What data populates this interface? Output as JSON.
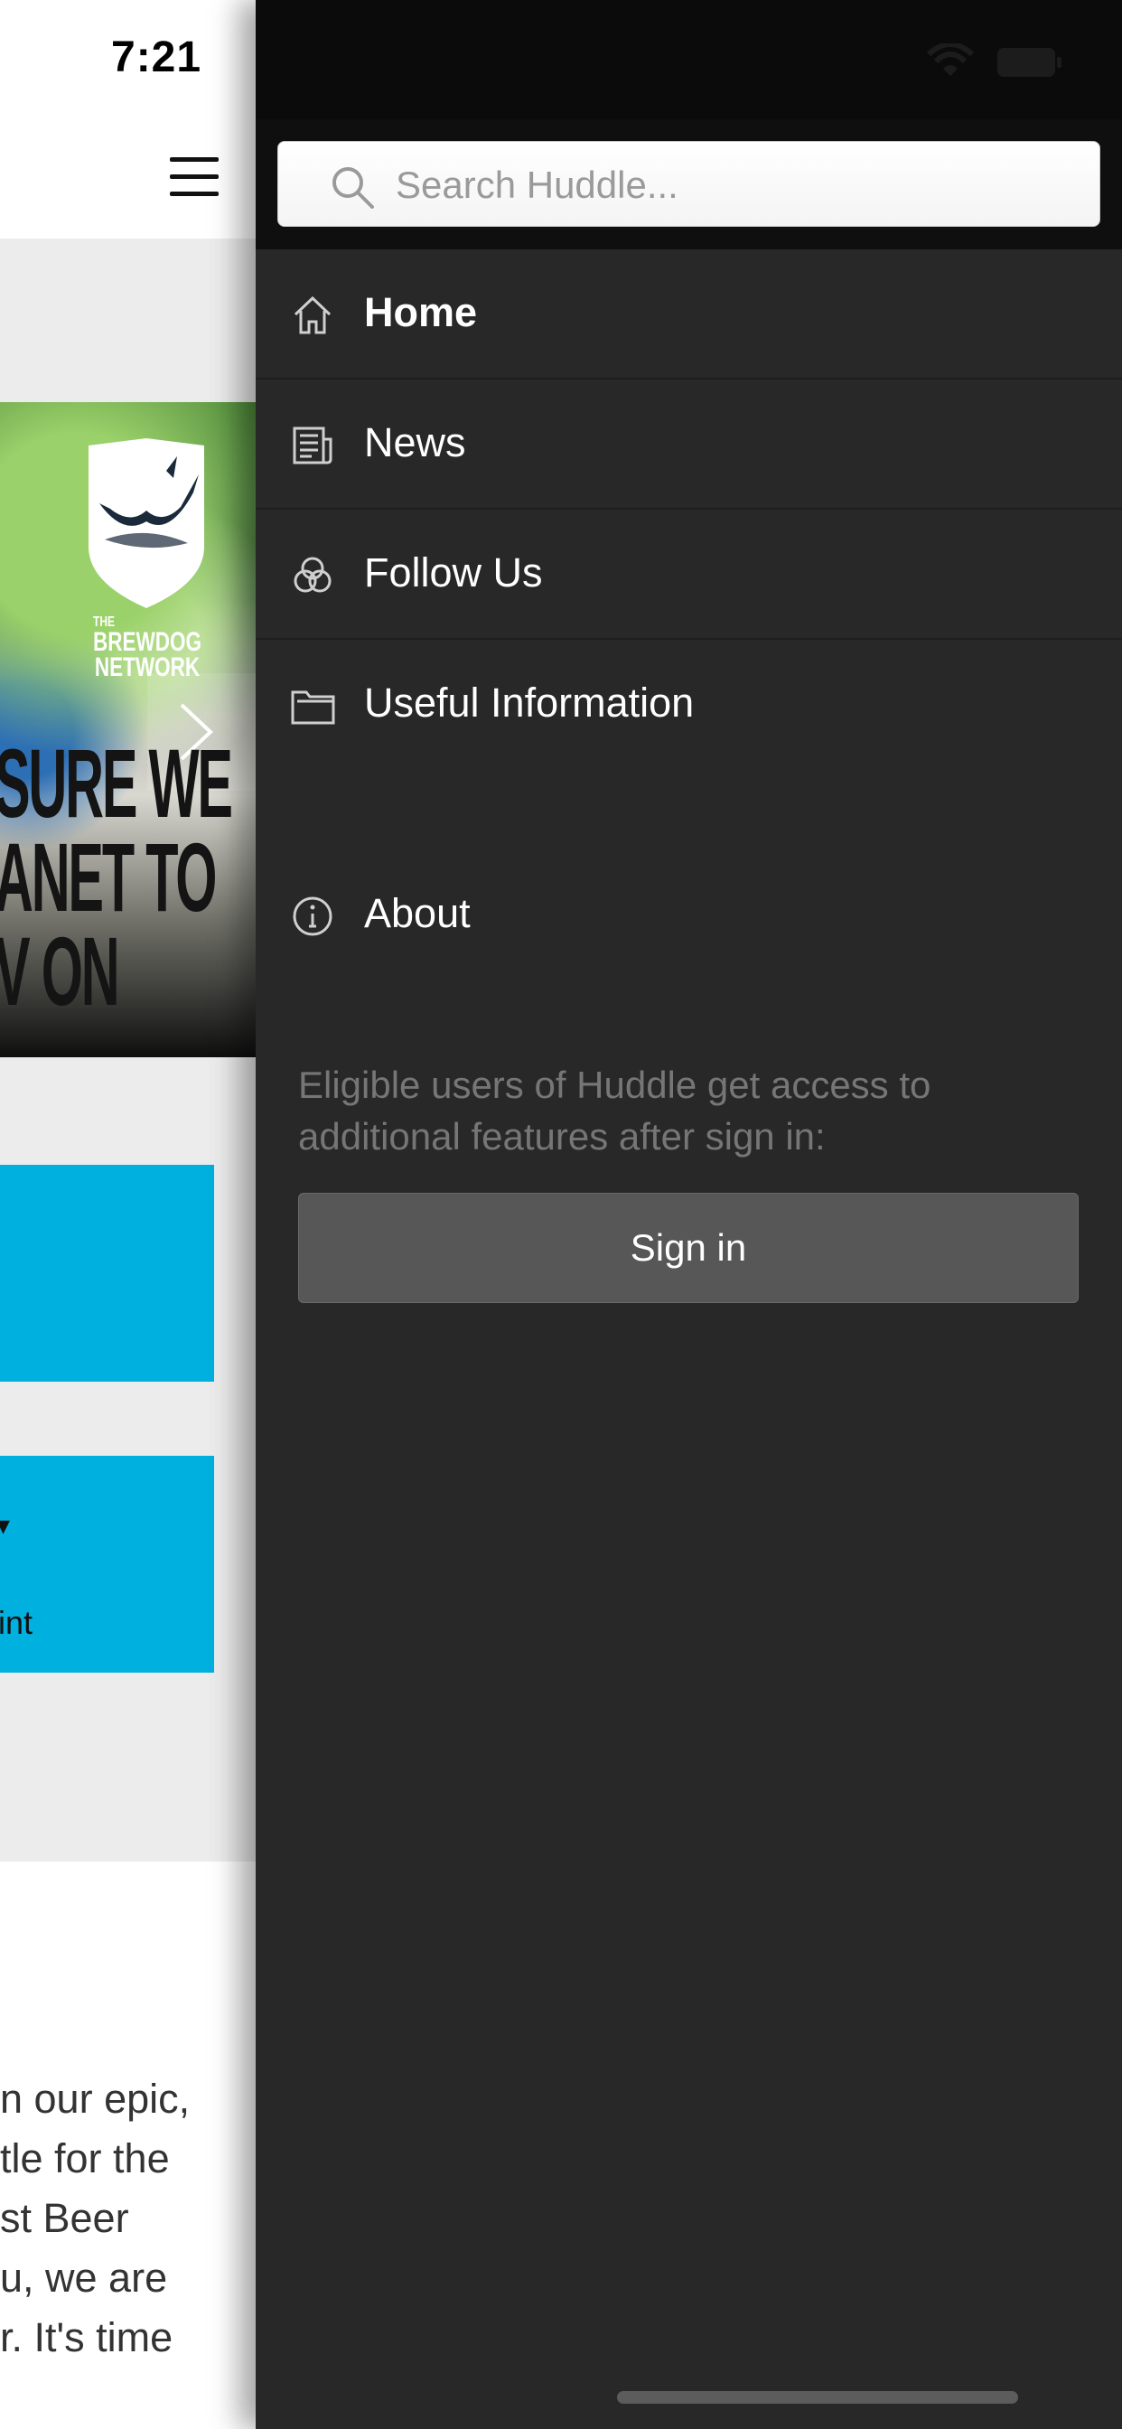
{
  "status_bar": {
    "time": "7:21"
  },
  "app": {
    "banner": {
      "logo_text_line1": "THE",
      "logo_text_line2": "BREWDOG",
      "logo_text_line3": "NETWORK",
      "headline": "SURE WE\nANET TO\nV ON"
    },
    "tile_2_caption": "int",
    "article_text": "n our epic,\ntle for the\nst Beer\nu, we are\nr. It's time"
  },
  "drawer": {
    "search": {
      "placeholder": "Search Huddle..."
    },
    "menu": [
      {
        "label": "Home",
        "icon": "home-icon"
      },
      {
        "label": "News",
        "icon": "newspaper-icon"
      },
      {
        "label": "Follow Us",
        "icon": "circles-icon"
      },
      {
        "label": "Useful Information",
        "icon": "folder-icon"
      },
      {
        "label": "About",
        "icon": "info-icon"
      }
    ],
    "signin_note": "Eligible users of Huddle get access to additional features after sign in:",
    "signin_label": "Sign in"
  },
  "colors": {
    "drawer_bg": "#282828",
    "tile_accent": "#00b0df"
  }
}
